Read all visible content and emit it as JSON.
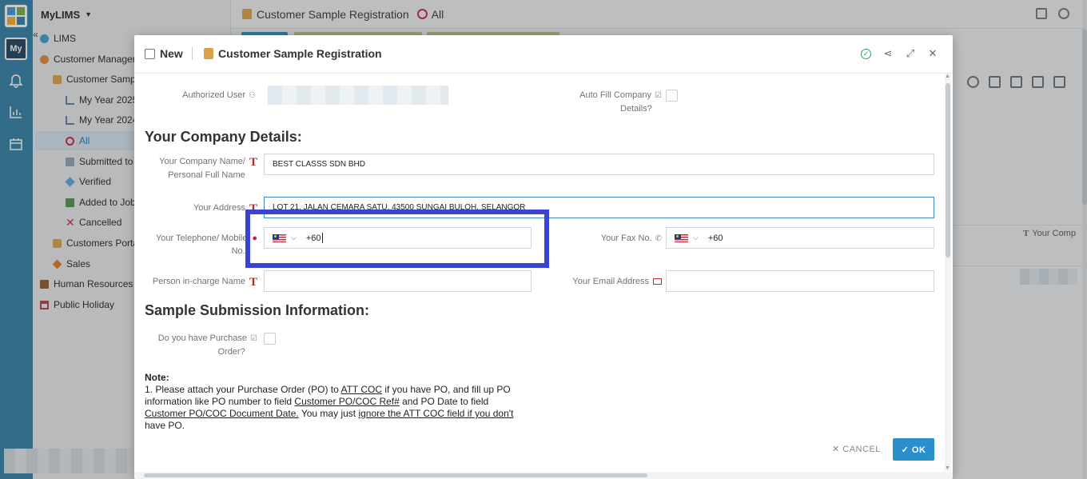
{
  "rail": {
    "my_label": "My"
  },
  "sidebar": {
    "app_title": "MyLIMS",
    "items": [
      {
        "label": "LIMS",
        "icon": "globe-icon"
      },
      {
        "label": "Customer Managem",
        "icon": "customer-icon"
      },
      {
        "label": "Customer Sample",
        "icon": "scroll-icon"
      },
      {
        "label": "My Year 2025",
        "icon": "chart-icon"
      },
      {
        "label": "My Year 2024",
        "icon": "chart-icon"
      },
      {
        "label": "All",
        "icon": "ring-icon"
      },
      {
        "label": "Submitted to",
        "icon": "document-icon"
      },
      {
        "label": "Verified",
        "icon": "diamond-icon"
      },
      {
        "label": "Added to Job",
        "icon": "download-icon"
      },
      {
        "label": "Cancelled",
        "icon": "cross-icon"
      },
      {
        "label": "Customers Porta",
        "icon": "portal-icon"
      },
      {
        "label": "Sales",
        "icon": "sales-icon"
      },
      {
        "label": "Human Resources",
        "icon": "hr-icon"
      },
      {
        "label": "Public Holiday",
        "icon": "calendar-icon"
      }
    ]
  },
  "topbar": {
    "breadcrumb": "Customer Sample Registration",
    "filter": "All"
  },
  "background": {
    "column_header": "Your Comp"
  },
  "modal": {
    "new_label": "New",
    "title": "Customer Sample Registration",
    "fields": {
      "authorized_user_label": "Authorized User",
      "auto_fill_label_1": "Auto Fill Company",
      "auto_fill_label_2": "Details?",
      "company_section": "Your Company Details:",
      "company_name_label_1": "Your Company Name/",
      "company_name_label_2": "Personal Full Name",
      "company_name_value": "BEST CLASSS SDN BHD",
      "address_label": "Your Address",
      "address_value": "LOT 21, JALAN CEMARA SATU, 43500 SUNGAI BULOH, SELANGOR",
      "telephone_label_1": "Your Telephone/ Mobile",
      "telephone_label_2": "No.",
      "telephone_value": "+60",
      "fax_label": "Your Fax No.",
      "fax_value": "+60",
      "person_label": "Person in-charge Name",
      "email_label": "Your Email Address",
      "sample_section": "Sample Submission Information:",
      "po_label_1": "Do you have Purchase",
      "po_label_2": "Order?"
    },
    "note": {
      "heading": "Note:",
      "l1a": "1. Please attach your Purchase Order (PO) to ",
      "l1b": "ATT COC",
      "l1c": " if you have PO, and fill up PO",
      "l2a": "information like PO number to field ",
      "l2b": "Customer PO/COC Ref#",
      "l2c": " and PO Date to field",
      "l3a": "Customer PO/COC Document Date.",
      "l3b": " You may just ",
      "l3c": "ignore the ATT COC field if you don't",
      "l4": "have PO."
    },
    "cancel_label": "✕ CANCEL",
    "ok_label": "✓ OK"
  }
}
